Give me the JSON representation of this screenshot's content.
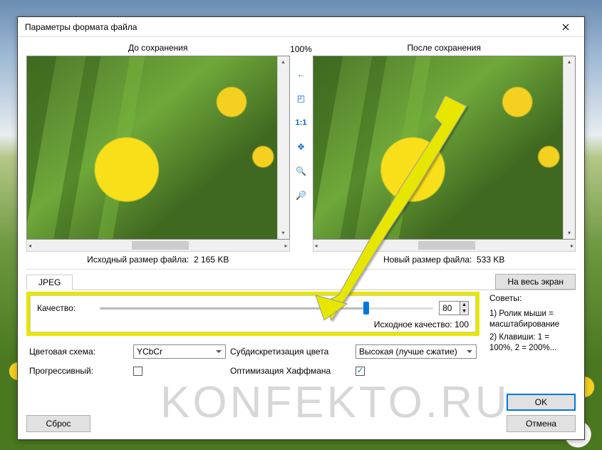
{
  "window": {
    "title": "Параметры формата файла"
  },
  "preview": {
    "before_label": "До сохранения",
    "after_label": "После сохранения",
    "zoom": "100%",
    "before_size_label": "Исходный размер файла:",
    "before_size_value": "2 165 KB",
    "after_size_label": "Новый размер файла:",
    "after_size_value": "533 KB"
  },
  "tabs": {
    "jpeg": "JPEG",
    "fullscreen": "На весь экран"
  },
  "quality": {
    "label": "Качество:",
    "value": "80",
    "original_label": "Исходное качество:",
    "original_value": "100"
  },
  "options": {
    "color_scheme_label": "Цветовая схема:",
    "color_scheme_value": "YCbCr",
    "subsampling_label": "Субдискретизация цвета",
    "subsampling_value": "Высокая (лучше сжатие)",
    "progressive_label": "Прогрессивный:",
    "huffman_label": "Оптимизация Хаффмана"
  },
  "tips": {
    "title": "Советы:",
    "tip1": "1) Ролик мыши = масштабирование",
    "tip2": "2) Клавиши: 1 = 100%, 2 = 200%..."
  },
  "buttons": {
    "reset": "Сброс",
    "ok": "OK",
    "cancel": "Отмена"
  },
  "watermark": "KONFEKTO.RU"
}
